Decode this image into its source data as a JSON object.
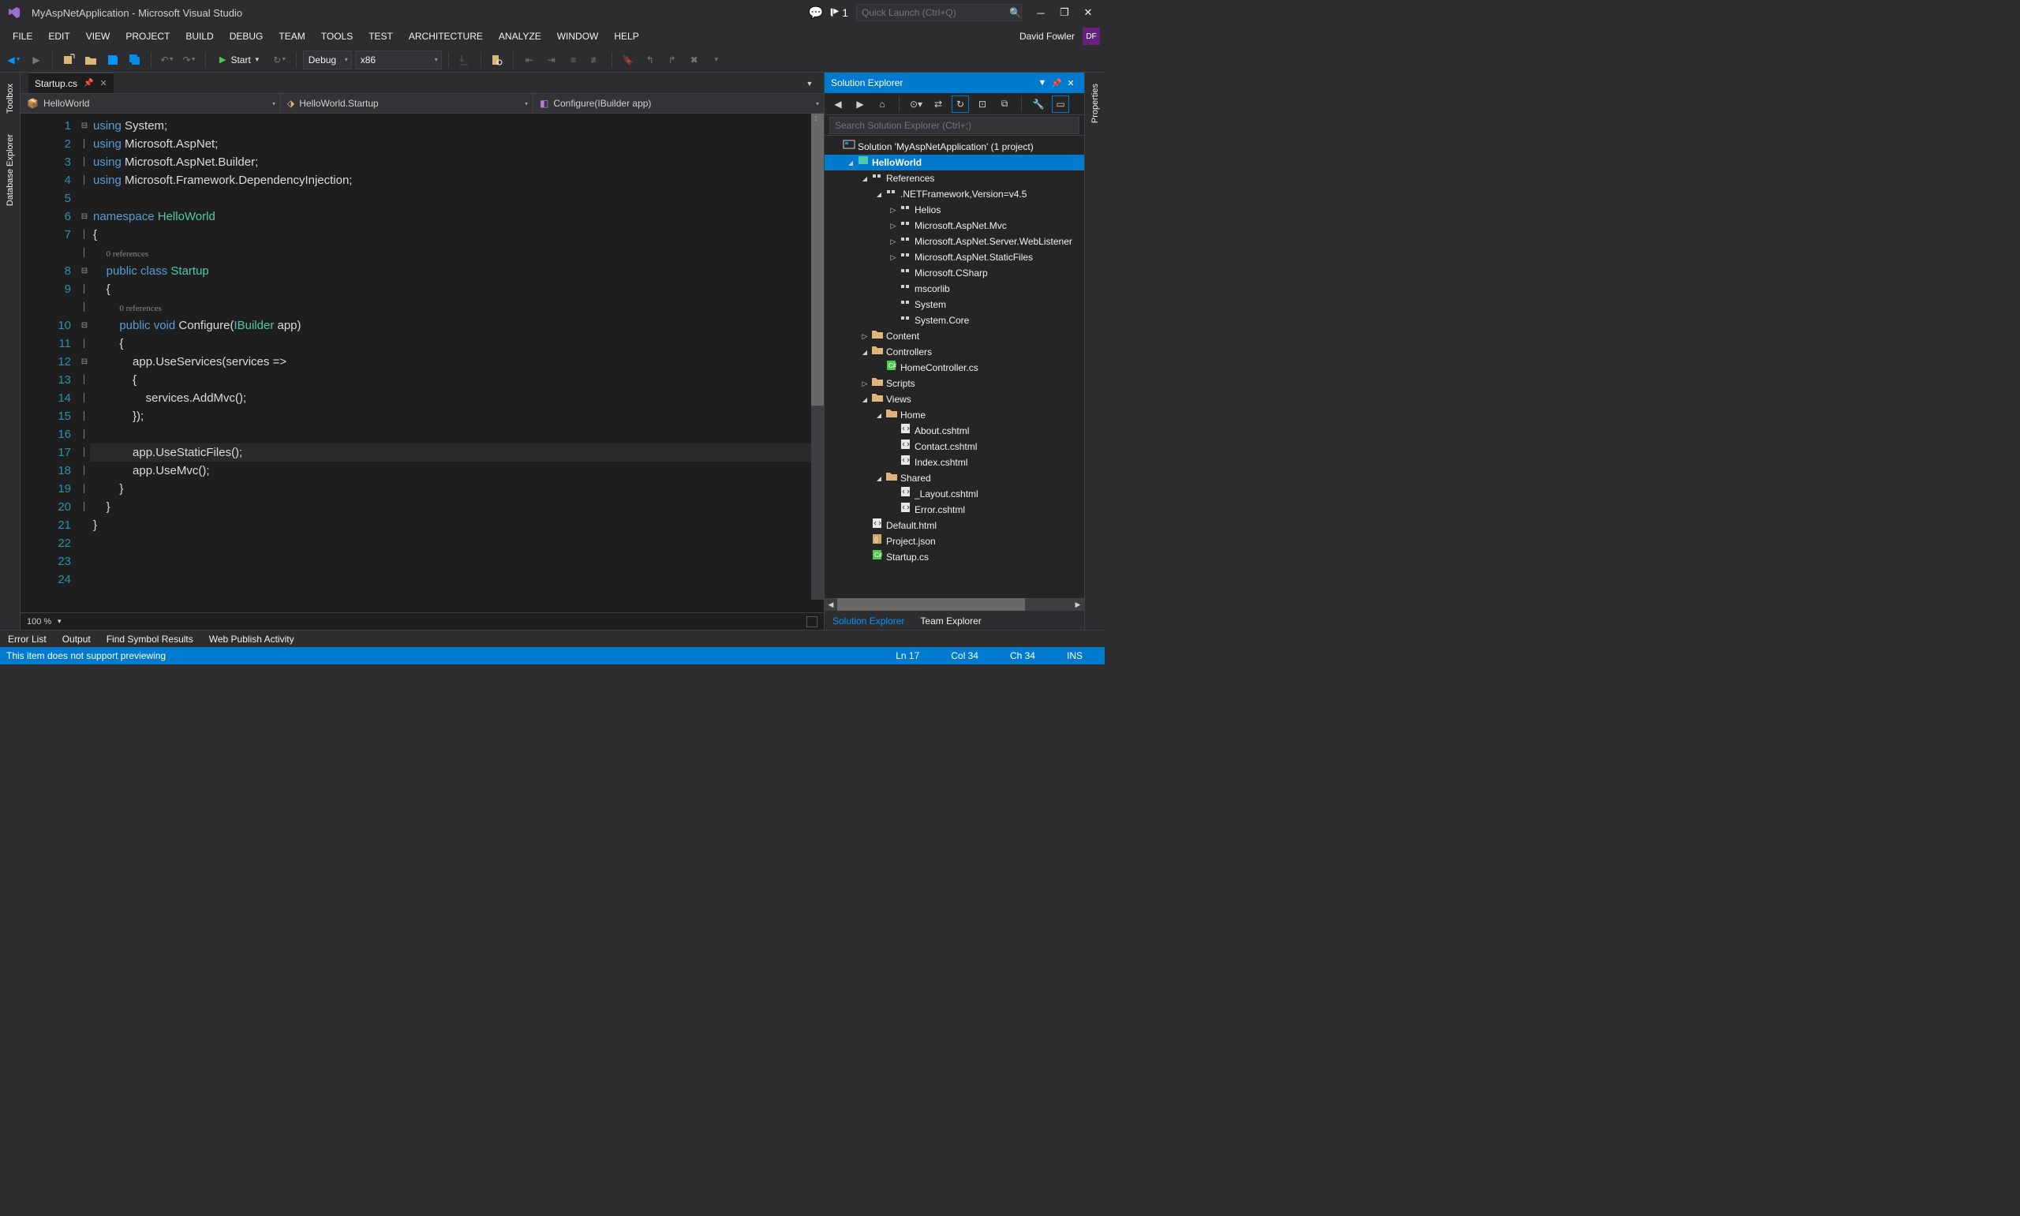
{
  "titlebar": {
    "title": "MyAspNetApplication - Microsoft Visual Studio",
    "flag_count": "1",
    "quick_launch_placeholder": "Quick Launch (Ctrl+Q)"
  },
  "menubar": {
    "items": [
      "FILE",
      "EDIT",
      "VIEW",
      "PROJECT",
      "BUILD",
      "DEBUG",
      "TEAM",
      "TOOLS",
      "TEST",
      "ARCHITECTURE",
      "ANALYZE",
      "WINDOW",
      "HELP"
    ],
    "user_name": "David Fowler",
    "user_initials": "DF"
  },
  "toolbar": {
    "start_label": "Start",
    "config_label": "Debug",
    "platform_label": "x86"
  },
  "left_sidebar": {
    "tabs": [
      "Toolbox",
      "Database Explorer"
    ]
  },
  "right_sidebar": {
    "tabs": [
      "Properties"
    ]
  },
  "editor": {
    "tab_name": "Startup.cs",
    "nav": {
      "project": "HelloWorld",
      "class": "HelloWorld.Startup",
      "member": "Configure(IBuilder app)"
    },
    "zoom": "100 %",
    "code_lines": [
      {
        "n": 1,
        "fold": "⊟",
        "html": "<span class='kw'>using</span> System;"
      },
      {
        "n": 2,
        "fold": "│",
        "html": "<span class='kw'>using</span> Microsoft.AspNet;"
      },
      {
        "n": 3,
        "fold": "│",
        "html": "<span class='kw'>using</span> Microsoft.AspNet.Builder;"
      },
      {
        "n": 4,
        "fold": "│",
        "html": "<span class='kw'>using</span> Microsoft.Framework.DependencyInjection;"
      },
      {
        "n": 5,
        "fold": "",
        "html": ""
      },
      {
        "n": 6,
        "fold": "⊟",
        "html": "<span class='kw'>namespace</span> <span class='type'>HelloWorld</span>"
      },
      {
        "n": 7,
        "fold": "│",
        "html": "{"
      },
      {
        "n": "",
        "fold": "│",
        "html": "    <span class='ref'>0 references</span>"
      },
      {
        "n": 8,
        "fold": "⊟",
        "html": "    <span class='kw'>public</span> <span class='kw'>class</span> <span class='type'>Startup</span>"
      },
      {
        "n": 9,
        "fold": "│",
        "html": "    {"
      },
      {
        "n": "",
        "fold": "│",
        "html": "        <span class='ref'>0 references</span>"
      },
      {
        "n": 10,
        "fold": "⊟",
        "html": "        <span class='kw'>public</span> <span class='kw'>void</span> Configure(<span class='type'>IBuilder</span> app)"
      },
      {
        "n": 11,
        "fold": "│",
        "html": "        {"
      },
      {
        "n": 12,
        "fold": "⊟",
        "html": "            app.UseServices(services =>"
      },
      {
        "n": 13,
        "fold": "│",
        "html": "            {"
      },
      {
        "n": 14,
        "fold": "│",
        "html": "                services.AddMvc();"
      },
      {
        "n": 15,
        "fold": "│",
        "html": "            });"
      },
      {
        "n": 16,
        "fold": "│",
        "html": ""
      },
      {
        "n": 17,
        "fold": "│",
        "html": "            app.UseStaticFiles();",
        "current": true
      },
      {
        "n": 18,
        "fold": "│",
        "html": "            app.UseMvc();"
      },
      {
        "n": 19,
        "fold": "│",
        "html": "        }"
      },
      {
        "n": 20,
        "fold": "│",
        "html": "    }"
      },
      {
        "n": 21,
        "fold": "",
        "html": "}"
      },
      {
        "n": 22,
        "fold": "",
        "html": ""
      },
      {
        "n": 23,
        "fold": "",
        "html": ""
      },
      {
        "n": 24,
        "fold": "",
        "html": ""
      }
    ]
  },
  "solution_explorer": {
    "title": "Solution Explorer",
    "search_placeholder": "Search Solution Explorer (Ctrl+;)",
    "tree": [
      {
        "depth": 0,
        "arrow": "",
        "icon": "sol",
        "label": "Solution 'MyAspNetApplication' (1 project)"
      },
      {
        "depth": 1,
        "arrow": "open",
        "icon": "proj",
        "label": "HelloWorld",
        "selected": true,
        "bold": true
      },
      {
        "depth": 2,
        "arrow": "open",
        "icon": "ref",
        "label": "References"
      },
      {
        "depth": 3,
        "arrow": "open",
        "icon": "ref",
        "label": ".NETFramework,Version=v4.5"
      },
      {
        "depth": 4,
        "arrow": "closed",
        "icon": "ref",
        "label": "Helios"
      },
      {
        "depth": 4,
        "arrow": "closed",
        "icon": "ref",
        "label": "Microsoft.AspNet.Mvc"
      },
      {
        "depth": 4,
        "arrow": "closed",
        "icon": "ref",
        "label": "Microsoft.AspNet.Server.WebListener"
      },
      {
        "depth": 4,
        "arrow": "closed",
        "icon": "ref",
        "label": "Microsoft.AspNet.StaticFiles"
      },
      {
        "depth": 4,
        "arrow": "",
        "icon": "ref",
        "label": "Microsoft.CSharp"
      },
      {
        "depth": 4,
        "arrow": "",
        "icon": "ref",
        "label": "mscorlib"
      },
      {
        "depth": 4,
        "arrow": "",
        "icon": "ref",
        "label": "System"
      },
      {
        "depth": 4,
        "arrow": "",
        "icon": "ref",
        "label": "System.Core"
      },
      {
        "depth": 2,
        "arrow": "closed",
        "icon": "folder",
        "label": "Content"
      },
      {
        "depth": 2,
        "arrow": "open",
        "icon": "folder",
        "label": "Controllers"
      },
      {
        "depth": 3,
        "arrow": "",
        "icon": "cs",
        "label": "HomeController.cs"
      },
      {
        "depth": 2,
        "arrow": "closed",
        "icon": "folder",
        "label": "Scripts"
      },
      {
        "depth": 2,
        "arrow": "open",
        "icon": "folder",
        "label": "Views"
      },
      {
        "depth": 3,
        "arrow": "open",
        "icon": "folder",
        "label": "Home"
      },
      {
        "depth": 4,
        "arrow": "",
        "icon": "html",
        "label": "About.cshtml"
      },
      {
        "depth": 4,
        "arrow": "",
        "icon": "html",
        "label": "Contact.cshtml"
      },
      {
        "depth": 4,
        "arrow": "",
        "icon": "html",
        "label": "Index.cshtml"
      },
      {
        "depth": 3,
        "arrow": "open",
        "icon": "folder",
        "label": "Shared"
      },
      {
        "depth": 4,
        "arrow": "",
        "icon": "html",
        "label": "_Layout.cshtml"
      },
      {
        "depth": 4,
        "arrow": "",
        "icon": "html",
        "label": "Error.cshtml"
      },
      {
        "depth": 2,
        "arrow": "",
        "icon": "html",
        "label": "Default.html"
      },
      {
        "depth": 2,
        "arrow": "",
        "icon": "json",
        "label": "Project.json"
      },
      {
        "depth": 2,
        "arrow": "",
        "icon": "cs",
        "label": "Startup.cs"
      }
    ],
    "tabs": [
      "Solution Explorer",
      "Team Explorer"
    ]
  },
  "bottom_tabs": [
    "Error List",
    "Output",
    "Find Symbol Results",
    "Web Publish Activity"
  ],
  "statusbar": {
    "message": "This item does not support previewing",
    "ln": "Ln 17",
    "col": "Col 34",
    "ch": "Ch 34",
    "ins": "INS"
  }
}
